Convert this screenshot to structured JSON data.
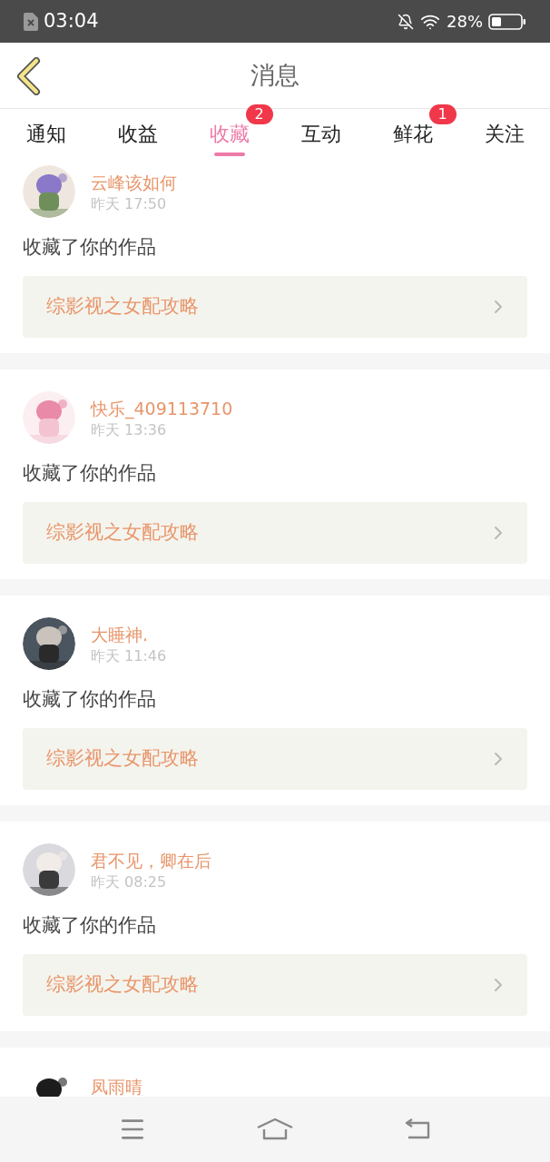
{
  "status_bar": {
    "time": "03:04",
    "battery": "28%"
  },
  "header": {
    "title": "消息"
  },
  "tabs": [
    {
      "label": "通知",
      "selected": false
    },
    {
      "label": "收益",
      "selected": false
    },
    {
      "label": "收藏",
      "selected": true,
      "badge": "2"
    },
    {
      "label": "互动",
      "selected": false
    },
    {
      "label": "鲜花",
      "selected": false,
      "badge": "1"
    },
    {
      "label": "关注",
      "selected": false
    }
  ],
  "messages": [
    {
      "name": "云峰该如何",
      "time": "昨天 17:50",
      "text": "收藏了你的作品",
      "work": "综影视之女配攻略"
    },
    {
      "name": "快乐_409113710",
      "time": "昨天 13:36",
      "text": "收藏了你的作品",
      "work": "综影视之女配攻略"
    },
    {
      "name": "大睡神.",
      "time": "昨天 11:46",
      "text": "收藏了你的作品",
      "work": "综影视之女配攻略"
    },
    {
      "name": "君不见，卿在后",
      "time": "昨天 08:25",
      "text": "收藏了你的作品",
      "work": "综影视之女配攻略"
    },
    {
      "name": "凤雨晴"
    }
  ]
}
